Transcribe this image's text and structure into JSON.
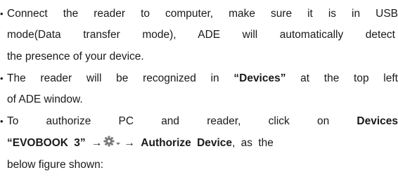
{
  "bullet_symbol": "•",
  "items": [
    {
      "line1": "Connect the reader to computer, make sure it is in USB",
      "line2": "mode(Data transfer mode), ADE will automatically detect",
      "line3": "the presence of your device."
    },
    {
      "line1_pre": "The reader will be recognized in ",
      "line1_bold": "“Devices”",
      "line1_post": " at the top left",
      "line2": "of ADE window."
    },
    {
      "line1_pre": "To authorize PC and reader, click on ",
      "line1_bold": "Devices",
      "line2_bold1": "“EVOBOOK 3”",
      "arrow": "→",
      "line2_bold2": "Authorize Device",
      "line2_post": ", as the",
      "line3": "below figure shown:"
    }
  ],
  "icons": {
    "settings": "gear-with-dropdown-icon",
    "arrow_color": "#1a1a1a",
    "gear_color": "#7a7a7a"
  }
}
